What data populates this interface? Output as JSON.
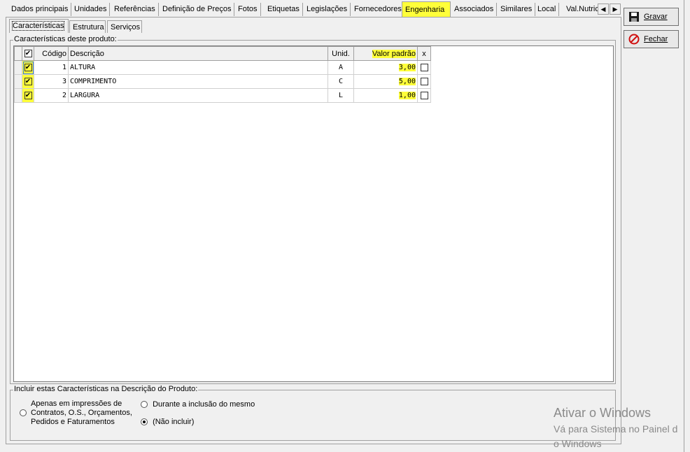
{
  "tabs": {
    "items": [
      {
        "label": "Dados principais"
      },
      {
        "label": "Unidades"
      },
      {
        "label": "Referências"
      },
      {
        "label": "Definição de Preços"
      },
      {
        "label": "Fotos"
      },
      {
        "label": "Etiquetas"
      },
      {
        "label": "Legislações"
      },
      {
        "label": "Fornecedores"
      },
      {
        "label": "Engenharia"
      },
      {
        "label": "Associados"
      },
      {
        "label": "Similares"
      },
      {
        "label": "Local"
      },
      {
        "label": "Val.Nutric"
      }
    ],
    "active": "Engenharia"
  },
  "subtabs": {
    "items": [
      {
        "label": "Características"
      },
      {
        "label": "Estrutura"
      },
      {
        "label": "Serviços"
      }
    ],
    "active": "Características"
  },
  "characteristics_group": {
    "title": "Características deste produto:"
  },
  "grid": {
    "headers": {
      "code": "Código",
      "description": "Descrição",
      "unit": "Unid.",
      "default_value": "Valor padrão",
      "x": "x"
    },
    "rows": [
      {
        "checked": true,
        "code": "1",
        "description": "ALTURA",
        "unit": "A",
        "value": "3,00",
        "x_checked": false
      },
      {
        "checked": true,
        "code": "3",
        "description": "COMPRIMENTO",
        "unit": "C",
        "value": "5,00",
        "x_checked": false
      },
      {
        "checked": true,
        "code": "2",
        "description": "LARGURA",
        "unit": "L",
        "value": "1,00",
        "x_checked": false
      }
    ]
  },
  "include_group": {
    "title": "Incluir estas Características na Descrição do Produto:",
    "option1_lines": [
      "Apenas em impressões de",
      "Contratos, O.S., Orçamentos,",
      "Pedidos e Faturamentos"
    ],
    "option2": "Durante a inclusão do mesmo",
    "option3": "(Não incluir)",
    "selected": "option3"
  },
  "buttons": {
    "save": "Gravar",
    "close": "Fechar"
  },
  "watermark": {
    "line1": "Ativar o Windows",
    "line2": "Vá para Sistema no Painel d",
    "line3": "o Windows"
  },
  "colors": {
    "highlight": "#ffff3a",
    "close_icon": "#d01010"
  }
}
